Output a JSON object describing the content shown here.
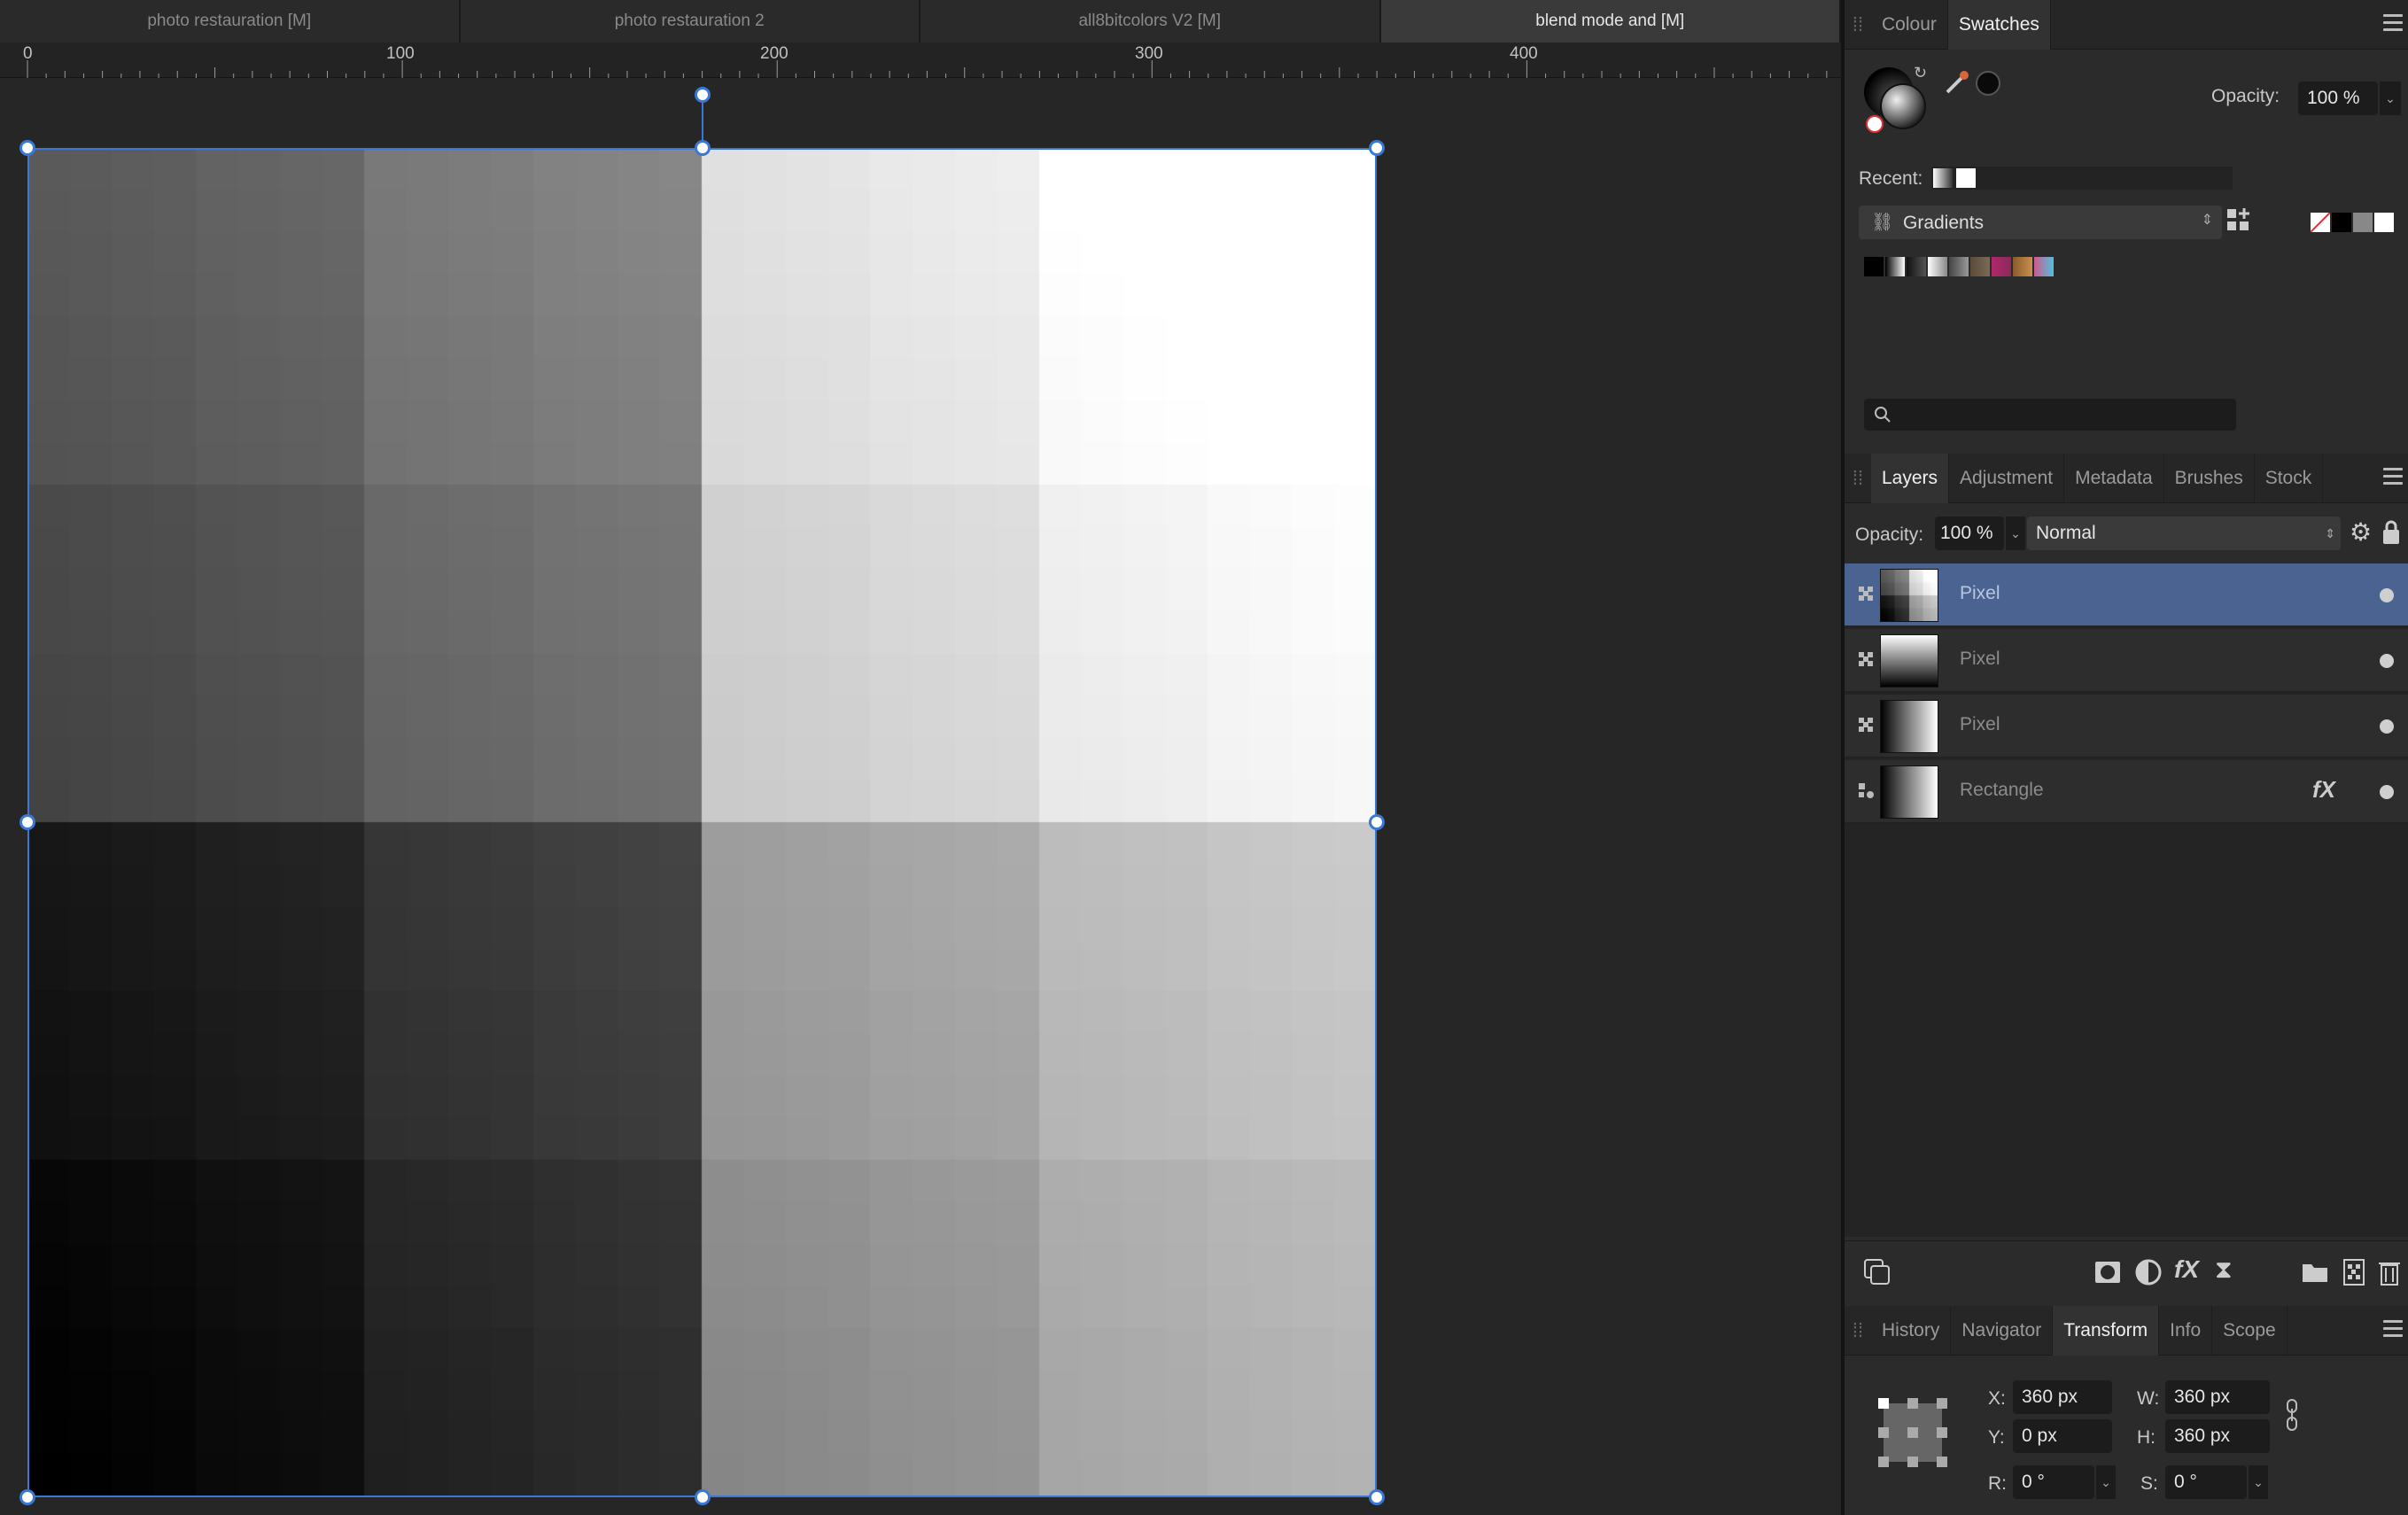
{
  "doc_tabs": [
    {
      "label": "photo restauration [M]",
      "active": false
    },
    {
      "label": "photo restauration 2",
      "active": false
    },
    {
      "label": "all8bitcolors V2 [M]",
      "active": false
    },
    {
      "label": "blend mode and [M]",
      "active": true
    }
  ],
  "ruler": {
    "labels": [
      "0",
      "100",
      "200",
      "300",
      "400"
    ]
  },
  "colour_panel": {
    "tabs": [
      "Colour",
      "Swatches"
    ],
    "active_tab": "Swatches",
    "opacity_label": "Opacity:",
    "opacity_value": "100 %",
    "recent_label": "Recent:",
    "palette_name": "Gradients",
    "search_placeholder": ""
  },
  "layers_panel": {
    "tabs": [
      "Layers",
      "Adjustment",
      "Metadata",
      "Brushes",
      "Stock"
    ],
    "active_tab": "Layers",
    "opacity_label": "Opacity:",
    "opacity_value": "100 %",
    "blend_mode": "Normal",
    "layers": [
      {
        "name": "Pixel",
        "selected": true,
        "has_fx": false
      },
      {
        "name": "Pixel",
        "selected": false,
        "has_fx": false
      },
      {
        "name": "Pixel",
        "selected": false,
        "has_fx": false
      },
      {
        "name": "Rectangle",
        "selected": false,
        "has_fx": true
      }
    ],
    "fx_label": "fX"
  },
  "transform_panel": {
    "tabs": [
      "History",
      "Navigator",
      "Transform",
      "Info",
      "Scope"
    ],
    "active_tab": "Transform",
    "x_label": "X:",
    "x_value": "360 px",
    "y_label": "Y:",
    "y_value": "0 px",
    "w_label": "W:",
    "w_value": "360 px",
    "h_label": "H:",
    "h_value": "360 px",
    "r_label": "R:",
    "r_value": "0 °",
    "s_label": "S:",
    "s_value": "0 °"
  },
  "colors": {
    "selection": "#3a78d6",
    "selected_layer": "#4a6390"
  }
}
